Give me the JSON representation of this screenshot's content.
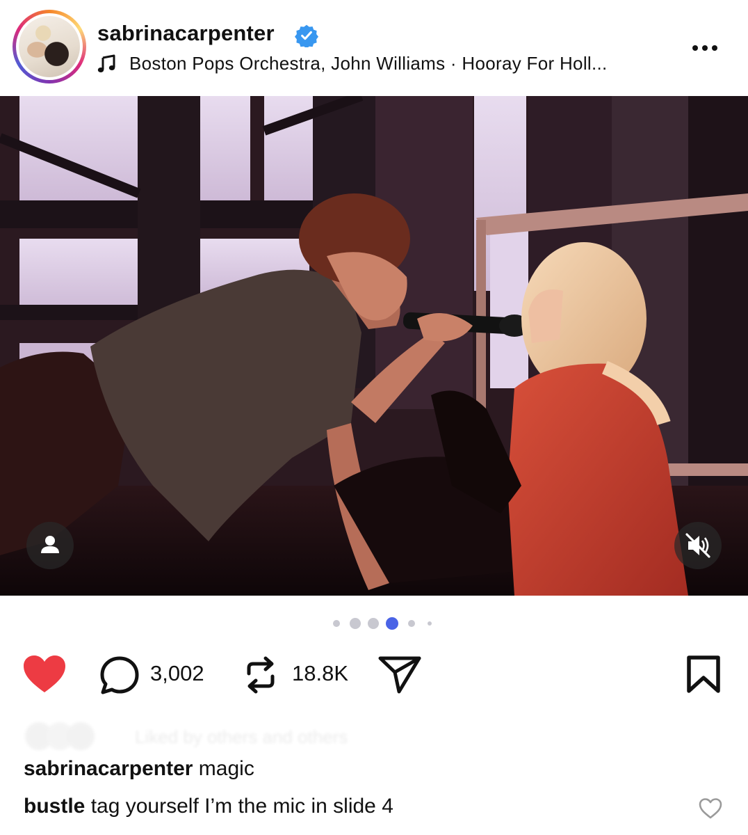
{
  "post": {
    "username": "sabrinacarpenter",
    "verified": true,
    "music_line": "Boston Pops Orchestra, John Williams · Hooray For Holl...",
    "icons": {
      "verified": "verified-badge-icon",
      "music": "music-note-icon",
      "more": "more-options-icon",
      "user_tag": "user-tag-icon",
      "mute": "muted-speaker-icon",
      "like": "heart-filled-icon",
      "comment": "comment-icon",
      "repost": "repost-icon",
      "share": "send-icon",
      "save": "bookmark-icon",
      "comment_like": "heart-outline-icon"
    },
    "carousel": {
      "total": 6,
      "active_index": 4
    },
    "stats": {
      "comments": "3,002",
      "reposts": "18.8K"
    },
    "liked_by_text": "Liked by others and others",
    "captions": [
      {
        "user": "sabrinacarpenter",
        "text": "magic"
      },
      {
        "user": "bustle",
        "text": "tag yourself I’m the mic in slide 4"
      }
    ],
    "colors": {
      "like_red": "#ed3b43",
      "verified_blue": "#3897f0",
      "active_dot": "#4a63e6",
      "inactive_dot": "#c8c8d0"
    }
  }
}
